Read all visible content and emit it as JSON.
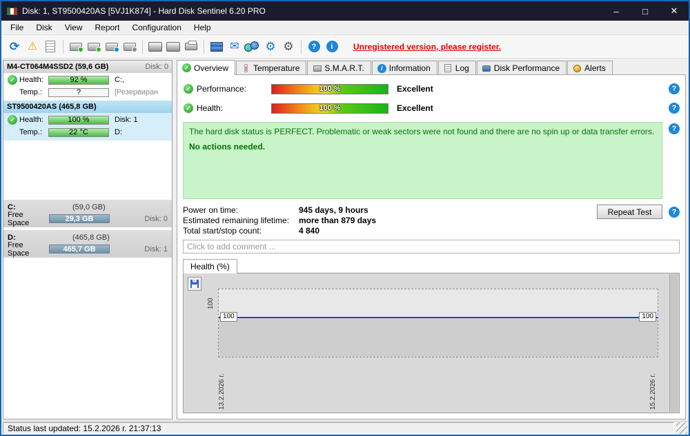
{
  "window": {
    "title": "Disk: 1, ST9500420AS [5VJ1K874]  -  Hard Disk Sentinel 6.20 PRO",
    "minimize": "–",
    "maximize": "□",
    "close": "✕"
  },
  "menu": {
    "file": "File",
    "disk": "Disk",
    "view": "View",
    "report": "Report",
    "configuration": "Configuration",
    "help": "Help"
  },
  "icons": {
    "refresh": "⟳",
    "warning": "⚠",
    "mail": "✉",
    "gear": "⚙",
    "question": "?",
    "info": "i",
    "check": "✓"
  },
  "toolbar": {
    "unregistered_text": "Unregistered version, please register."
  },
  "sidebar": {
    "disks": [
      {
        "name": "M4-CT064M4SSD2 (59,6 GB)",
        "disk_num": "Disk: 0",
        "health_label": "Health:",
        "health_value": "92 %",
        "health_right": "C:,",
        "temp_label": "Temp.:",
        "temp_value": "?",
        "temp_right": "[Резервиран"
      },
      {
        "name": "ST9500420AS (465,8 GB)",
        "disk_num": "",
        "health_label": "Health:",
        "health_value": "100 %",
        "health_right": "Disk: 1",
        "temp_label": "Temp.:",
        "temp_value": "22 °C",
        "temp_right": "D:"
      }
    ],
    "partitions": [
      {
        "drive": "C:",
        "size": "(59,0 GB)",
        "free_label": "Free Space",
        "free_value": "29,3 GB",
        "disk_num": "Disk: 0"
      },
      {
        "drive": "D:",
        "size": "(465,8 GB)",
        "free_label": "Free Space",
        "free_value": "465,7 GB",
        "disk_num": "Disk: 1"
      }
    ]
  },
  "tabs": {
    "overview": "Overview",
    "temperature": "Temperature",
    "smart": "S.M.A.R.T.",
    "information": "Information",
    "log": "Log",
    "disk_performance": "Disk Performance",
    "alerts": "Alerts"
  },
  "overview": {
    "performance_label": "Performance:",
    "performance_value": "100 %",
    "performance_rating": "Excellent",
    "health_label": "Health:",
    "health_value": "100 %",
    "health_rating": "Excellent",
    "status_line1": "The hard disk status is PERFECT. Problematic or weak sectors were not found and there are no spin up or data transfer errors.",
    "status_line2": "No actions needed.",
    "power_on_label": "Power on time:",
    "power_on_value": "945 days, 9 hours",
    "lifetime_label": "Estimated remaining lifetime:",
    "lifetime_value": "more than 879 days",
    "startstop_label": "Total start/stop count:",
    "startstop_value": "4 840",
    "repeat_test_label": "Repeat Test",
    "comment_placeholder": "Click to add comment ..."
  },
  "chart": {
    "tab_label": "Health (%)",
    "y_axis_label": "100",
    "value_left": "100",
    "value_right": "100",
    "date_start": "13.2.2026 г.",
    "date_end": "15.2.2026 г.",
    "chart_data": {
      "type": "line",
      "title": "Health (%)",
      "x": [
        "13.2.2026",
        "15.2.2026"
      ],
      "series": [
        {
          "name": "Health (%)",
          "values": [
            100,
            100
          ]
        }
      ],
      "ylim": [
        0,
        100
      ]
    }
  },
  "statusbar": {
    "text": "Status last updated: 15.2.2026 г. 21:37:13"
  }
}
